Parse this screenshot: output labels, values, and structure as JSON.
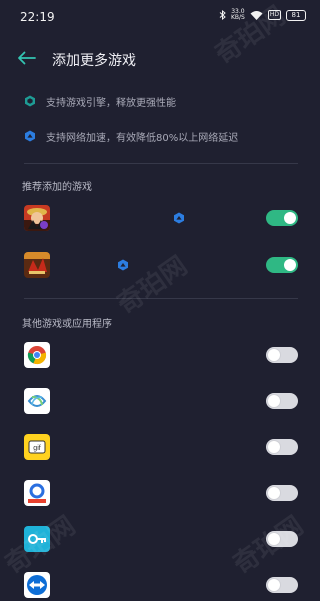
{
  "status_bar": {
    "time": "22:19",
    "net_speed_value": "33.0",
    "net_speed_unit": "KB/S",
    "hd_label": "HD",
    "battery": "81",
    "icons": [
      "bluetooth-icon",
      "wifi-icon",
      "battery-icon"
    ]
  },
  "header": {
    "back_icon": "arrow-left-icon",
    "title": "添加更多游戏"
  },
  "features": [
    {
      "icon": "engine-icon",
      "text": "支持游戏引擎，释放更强性能"
    },
    {
      "icon": "network-icon",
      "text": "支持网络加速，有效降低80%以上网络延迟"
    }
  ],
  "recommended": {
    "title": "推荐添加的游戏",
    "items": [
      {
        "icon": "one-piece-game-icon",
        "badge": "game-badge-icon",
        "enabled": true
      },
      {
        "icon": "three-kingdoms-game-icon",
        "badge": "game-badge-icon",
        "enabled": true
      }
    ]
  },
  "others": {
    "title": "其他游戏或应用程序",
    "items": [
      {
        "icon": "chrome-app-icon",
        "enabled": false
      },
      {
        "icon": "swirl-app-icon",
        "enabled": false
      },
      {
        "icon": "gif-app-icon",
        "enabled": false
      },
      {
        "icon": "search-app-icon",
        "enabled": false
      },
      {
        "icon": "key-app-icon",
        "enabled": false
      },
      {
        "icon": "teamviewer-app-icon",
        "enabled": false
      }
    ]
  },
  "colors": {
    "background": "#1f2030",
    "accent": "#2fb884",
    "back_arrow": "#33c4b2",
    "feature_icon": "#2c7de0"
  },
  "watermark": "奇珀网",
  "gif_icon_text": "gif"
}
